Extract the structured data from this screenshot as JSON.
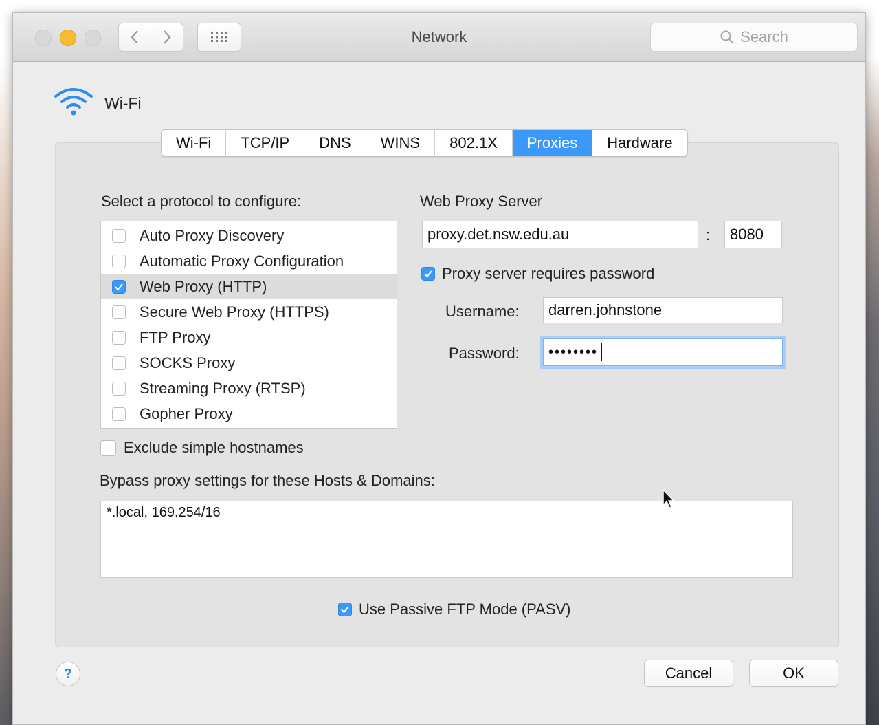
{
  "window": {
    "title": "Network",
    "search_placeholder": "Search"
  },
  "header": {
    "interface_name": "Wi-Fi"
  },
  "tabs": [
    {
      "label": "Wi-Fi",
      "active": false
    },
    {
      "label": "TCP/IP",
      "active": false
    },
    {
      "label": "DNS",
      "active": false
    },
    {
      "label": "WINS",
      "active": false
    },
    {
      "label": "802.1X",
      "active": false
    },
    {
      "label": "Proxies",
      "active": true
    },
    {
      "label": "Hardware",
      "active": false
    }
  ],
  "protocols": {
    "heading": "Select a protocol to configure:",
    "items": [
      {
        "label": "Auto Proxy Discovery",
        "checked": false,
        "selected": false
      },
      {
        "label": "Automatic Proxy Configuration",
        "checked": false,
        "selected": false
      },
      {
        "label": "Web Proxy (HTTP)",
        "checked": true,
        "selected": true
      },
      {
        "label": "Secure Web Proxy (HTTPS)",
        "checked": false,
        "selected": false
      },
      {
        "label": "FTP Proxy",
        "checked": false,
        "selected": false
      },
      {
        "label": "SOCKS Proxy",
        "checked": false,
        "selected": false
      },
      {
        "label": "Streaming Proxy (RTSP)",
        "checked": false,
        "selected": false
      },
      {
        "label": "Gopher Proxy",
        "checked": false,
        "selected": false
      }
    ]
  },
  "proxy_server": {
    "heading": "Web Proxy Server",
    "host": "proxy.det.nsw.edu.au",
    "separator": ":",
    "port": "8080",
    "requires_password_label": "Proxy server requires password",
    "requires_password_checked": true,
    "username_label": "Username:",
    "username": "darren.johnstone",
    "password_label": "Password:",
    "password_masked": "••••••••"
  },
  "exclude_simple": {
    "label": "Exclude simple hostnames",
    "checked": false
  },
  "bypass": {
    "label": "Bypass proxy settings for these Hosts & Domains:",
    "value": "*.local, 169.254/16"
  },
  "passive_ftp": {
    "label": "Use Passive FTP Mode (PASV)",
    "checked": true
  },
  "footer": {
    "help_label": "?",
    "cancel_label": "Cancel",
    "ok_label": "OK"
  },
  "colors": {
    "accent": "#3b99fc",
    "minimize": "#f5bd2f",
    "window_bg": "#ececec"
  },
  "icons": [
    "wifi-icon",
    "back-chevron-icon",
    "forward-chevron-icon",
    "grid-icon",
    "magnifier-icon",
    "checkmark-icon",
    "mouse-pointer-icon"
  ]
}
